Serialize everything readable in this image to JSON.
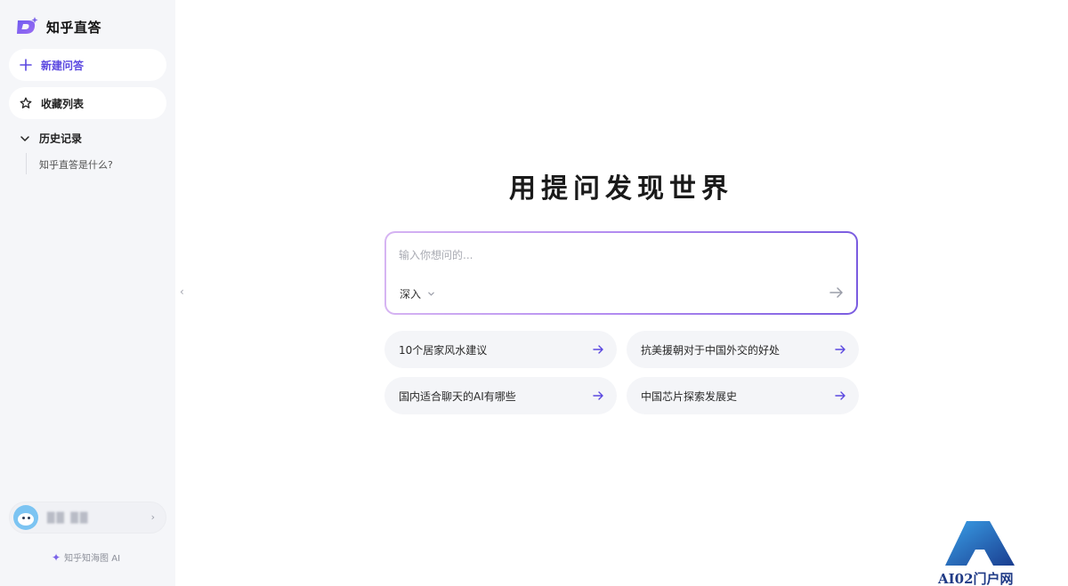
{
  "app": {
    "name": "知乎直答",
    "accent": "#5b48e0"
  },
  "sidebar": {
    "new_chat": "新建问答",
    "favorites": "收藏列表",
    "history": {
      "label": "历史记录",
      "items": [
        "知乎直答是什么?"
      ]
    },
    "user": {
      "name": "██ ██"
    },
    "footer": "知乎知海图 AI"
  },
  "main": {
    "title": "用提问发现世界",
    "input": {
      "placeholder": "输入你想问的...",
      "value": ""
    },
    "mode": "深入",
    "suggestions": [
      "10个居家风水建议",
      "抗美援朝对于中国外交的好处",
      "国内适合聊天的AI有哪些",
      "中国芯片探索发展史"
    ]
  },
  "watermark": {
    "text": "AI02门户网"
  },
  "icons": [
    "logo-icon",
    "plus-icon",
    "star-icon",
    "chevron-down-icon",
    "avatar",
    "chevron-right-icon",
    "sparkle-icon",
    "collapse-icon",
    "arrow-right-icon"
  ]
}
